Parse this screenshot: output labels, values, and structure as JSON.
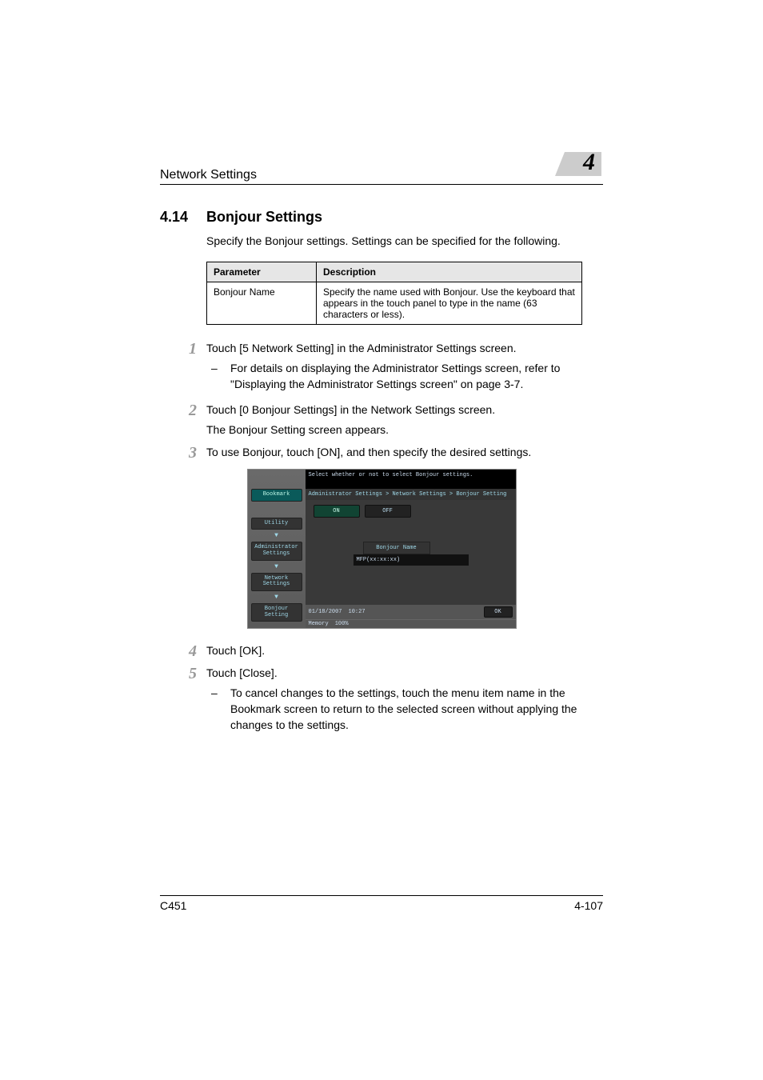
{
  "header": {
    "running_title": "Network Settings",
    "chapter_number": "4"
  },
  "section": {
    "number": "4.14",
    "title": "Bonjour Settings",
    "intro": "Specify the Bonjour settings. Settings can be specified for the following."
  },
  "table": {
    "col1": "Parameter",
    "col2": "Description",
    "row1_param": "Bonjour Name",
    "row1_desc": "Specify the name used with Bonjour. Use the keyboard that appears in the touch panel to type in the name (63 characters or less)."
  },
  "steps": {
    "s1_num": "1",
    "s1_text": "Touch [5 Network Setting] in the Administrator Settings screen.",
    "s1_sub": "For details on displaying the Administrator Settings screen, refer to \"Displaying the Administrator Settings screen\" on page 3-7.",
    "s2_num": "2",
    "s2_text": "Touch [0 Bonjour Settings] in the Network Settings screen.",
    "s2_extra": "The Bonjour Setting screen appears.",
    "s3_num": "3",
    "s3_text": "To use Bonjour, touch [ON], and then specify the desired settings.",
    "s4_num": "4",
    "s4_text": "Touch [OK].",
    "s5_num": "5",
    "s5_text": "Touch [Close].",
    "s5_sub": "To cancel changes to the settings, touch the menu item name in the Bookmark screen to return to the selected screen without applying the changes to the settings."
  },
  "dash": "–",
  "screen": {
    "prompt": "Select whether or not to select Bonjour settings.",
    "breadcrumb": "Administrator Settings > Network Settings > Bonjour Setting",
    "on": "ON",
    "off": "OFF",
    "bonjour_name_label": "Bonjour Name",
    "bonjour_name_value": "MFP(xx:xx:xx)",
    "bookmark": "Bookmark",
    "utility": "Utility",
    "admin": "Administrator\nSettings",
    "net": "Network\nSettings",
    "bonjour": "Bonjour Setting",
    "date": "01/18/2007",
    "time": "10:27",
    "memory": "Memory",
    "memory_pct": "100%",
    "ok": "OK"
  },
  "footer": {
    "model": "C451",
    "page": "4-107"
  }
}
